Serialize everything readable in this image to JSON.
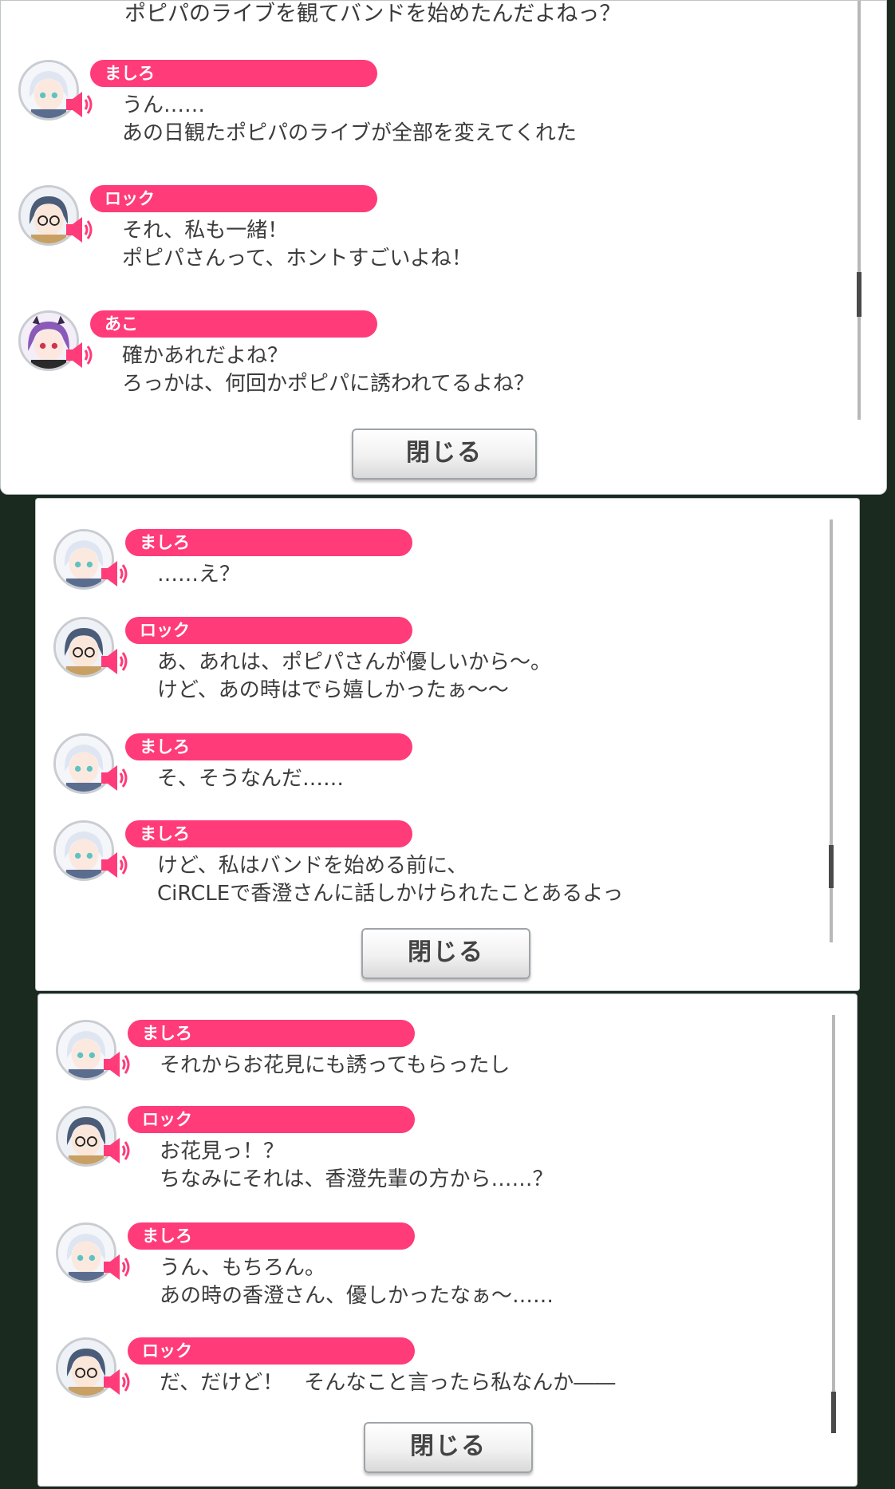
{
  "close_label": "閉じる",
  "accent_color": "#ff3b79",
  "panels": [
    {
      "partial_line": "ポピパのライブを観てバンドを始めたんだよねっ？",
      "messages": [
        {
          "speaker": "ましろ",
          "character": "mashiro",
          "lines": [
            "うん……",
            "あの日観たポピパのライブが全部を変えてくれた"
          ]
        },
        {
          "speaker": "ロック",
          "character": "rokku",
          "lines": [
            "それ、私も一緒！",
            "ポピパさんって、ホントすごいよね！"
          ]
        },
        {
          "speaker": "あこ",
          "character": "ako",
          "lines": [
            "確かあれだよね？",
            "ろっかは、何回かポピパに誘われてるよね？"
          ]
        }
      ]
    },
    {
      "messages": [
        {
          "speaker": "ましろ",
          "character": "mashiro",
          "lines": [
            "……え？"
          ]
        },
        {
          "speaker": "ロック",
          "character": "rokku",
          "lines": [
            "あ、あれは、ポピパさんが優しいから～。",
            "けど、あの時はでら嬉しかったぁ～～"
          ]
        },
        {
          "speaker": "ましろ",
          "character": "mashiro",
          "lines": [
            "そ、そうなんだ……"
          ]
        },
        {
          "speaker": "ましろ",
          "character": "mashiro",
          "lines": [
            "けど、私はバンドを始める前に、",
            "CiRCLEで香澄さんに話しかけられたことあるよっ"
          ]
        }
      ]
    },
    {
      "messages": [
        {
          "speaker": "ましろ",
          "character": "mashiro",
          "lines": [
            "それからお花見にも誘ってもらったし"
          ]
        },
        {
          "speaker": "ロック",
          "character": "rokku",
          "lines": [
            "お花見っ！？",
            "ちなみにそれは、香澄先輩の方から……？"
          ]
        },
        {
          "speaker": "ましろ",
          "character": "mashiro",
          "lines": [
            "うん、もちろん。",
            "あの時の香澄さん、優しかったなぁ～……"
          ]
        },
        {
          "speaker": "ロック",
          "character": "rokku",
          "lines": [
            "だ、だけど！　そんなこと言ったら私なんか――"
          ]
        }
      ]
    }
  ]
}
